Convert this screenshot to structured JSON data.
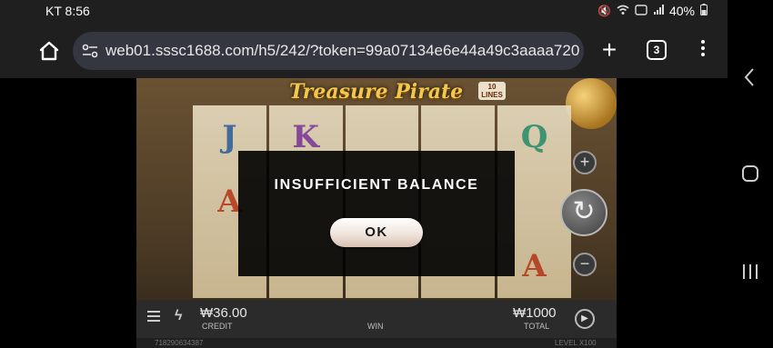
{
  "status_bar": {
    "time": "KT 8:56",
    "battery": "40%",
    "icons": [
      "mute-icon",
      "wifi-icon",
      "hd-icon",
      "signal-icon",
      "battery-icon"
    ]
  },
  "browser": {
    "url": "web01.sssc1688.com/h5/242/?token=99a07134e6e44a49c3aaaa720",
    "tab_count": "3",
    "icons": [
      "home-icon",
      "site-settings-icon",
      "plus-icon",
      "more-vert-icon"
    ]
  },
  "game": {
    "title": "Treasure Pirate",
    "lines_badge": "10 LINES",
    "reel_symbols": [
      [
        "J",
        "A",
        ""
      ],
      [
        "K",
        "",
        ""
      ],
      [
        "",
        "",
        ""
      ],
      [
        "",
        "",
        ""
      ],
      [
        "Q",
        "",
        "A"
      ]
    ],
    "credit_value": "₩36.00",
    "credit_label": "CREDIT",
    "win_label": "WIN",
    "total_value": "₩1000",
    "total_label": "TOTAL",
    "footer_id": "718290634387",
    "level_label": "LEVEL",
    "level_value": "X100"
  },
  "modal": {
    "title": "INSUFFICIENT BALANCE",
    "ok_label": "OK"
  },
  "colors": {
    "modal_bg": "#000000",
    "ok_button": "#efe4dc",
    "browser_chrome": "#1f1f1f",
    "url_bar": "#343640"
  }
}
